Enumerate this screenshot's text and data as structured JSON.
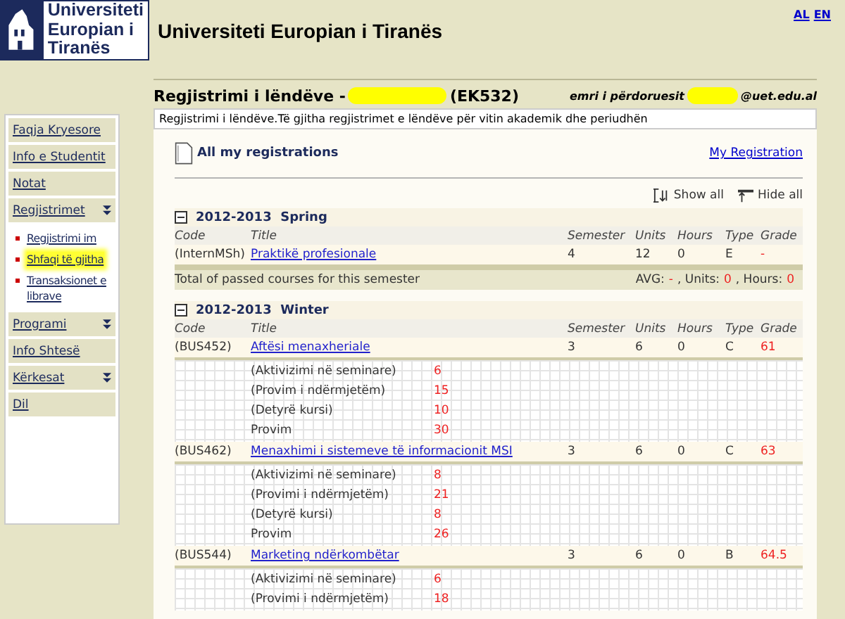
{
  "logo": {
    "lines": [
      "Universiteti",
      "Europian i",
      "Tiranës"
    ]
  },
  "site_title": "Universiteti Europian i Tiranës",
  "languages": [
    {
      "label": "AL"
    },
    {
      "label": "EN"
    }
  ],
  "sidebar": {
    "items": [
      {
        "label": "Faqja Kryesore",
        "expandable": false
      },
      {
        "label": "Info e Studentit",
        "expandable": false
      },
      {
        "label": "Notat",
        "expandable": false
      },
      {
        "label": "Regjistrimet",
        "expandable": true,
        "children": [
          {
            "label": "Regjistrimi im",
            "selected": false
          },
          {
            "label": "Shfaqi të gjitha",
            "selected": true
          },
          {
            "label": "Transaksionet e librave",
            "selected": false
          }
        ]
      },
      {
        "label": "Programi",
        "expandable": true
      },
      {
        "label": "Info Shtesë",
        "expandable": false
      },
      {
        "label": "Kërkesat",
        "expandable": true
      },
      {
        "label": "Dil",
        "expandable": false
      }
    ]
  },
  "page": {
    "heading": "Regjistrimi i lëndëve -",
    "heading_code": "(EK532)",
    "user_label": "emri i përdoruesit",
    "user_domain": "@uet.edu.al",
    "description": "Regjistrimi i lëndëve.Të gjitha regjistrimet e lëndëve për vitin akademik dhe periudhën"
  },
  "registrations": {
    "title": "All my registrations",
    "link": "My Registration",
    "show_all": "Show all",
    "hide_all": "Hide all",
    "semesters": [
      {
        "title": "2012-2013  Spring",
        "expanded": true,
        "columns": [
          "Code",
          "Title",
          "Semester",
          "Units",
          "Hours",
          "Type",
          "Grade"
        ],
        "courses": [
          {
            "code": "(InternMSh)",
            "title": "Praktikë profesionale",
            "semester": "4",
            "units": "12",
            "hours": "0",
            "type": "E",
            "grade": "-"
          }
        ],
        "total": {
          "label": "Total of passed courses for this semester",
          "avg_label": "AVG:",
          "avg": "-",
          "units_label": ", Units:",
          "units": "0",
          "hours_label": ", Hours:",
          "hours": "0"
        }
      },
      {
        "title": "2012-2013  Winter",
        "expanded": true,
        "columns": [
          "Code",
          "Title",
          "Semester",
          "Units",
          "Hours",
          "Type",
          "Grade"
        ],
        "courses": [
          {
            "code": "(BUS452)",
            "title": "Aftësi menaxheriale",
            "semester": "3",
            "units": "6",
            "hours": "0",
            "type": "C",
            "grade": "61",
            "components": [
              {
                "label": "(Aktivizimi në seminare)",
                "score": "6"
              },
              {
                "label": "(Provim i ndërmjetëm)",
                "score": "15"
              },
              {
                "label": "(Detyrë kursi)",
                "score": "10"
              },
              {
                "label": "Provim",
                "score": "30"
              }
            ]
          },
          {
            "code": "(BUS462)",
            "title": "Menaxhimi i sistemeve të informacionit MSI",
            "semester": "3",
            "units": "6",
            "hours": "0",
            "type": "C",
            "grade": "63",
            "components": [
              {
                "label": "(Aktivizimi në seminare)",
                "score": "8"
              },
              {
                "label": "(Provimi i ndërmjetëm)",
                "score": "21"
              },
              {
                "label": "(Detyrë kursi)",
                "score": "8"
              },
              {
                "label": "Provim",
                "score": "26"
              }
            ]
          },
          {
            "code": "(BUS544)",
            "title": "Marketing ndërkombëtar",
            "semester": "3",
            "units": "6",
            "hours": "0",
            "type": "B",
            "grade": "64.5",
            "components": [
              {
                "label": "(Aktivizimi në seminare)",
                "score": "6"
              },
              {
                "label": "(Provimi i ndërmjetëm)",
                "score": "18"
              }
            ]
          }
        ]
      }
    ]
  }
}
